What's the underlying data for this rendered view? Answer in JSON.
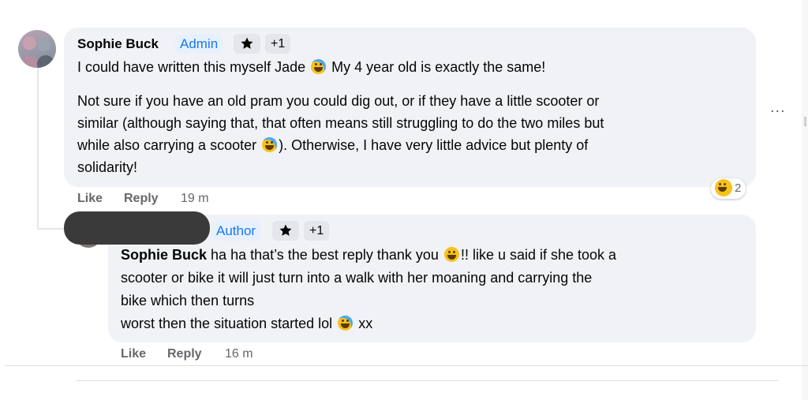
{
  "comment": {
    "author": "Sophie Buck",
    "role_badge": "Admin",
    "extra_badges": "+1",
    "line1_a": "I could have written this myself Jade",
    "line1_b": "My 4 year old is exactly the same!",
    "para2_l1": "Not sure if you have an old pram you could dig out, or if they have a little scooter or",
    "para2_l2": "similar (although saying that, that often means still struggling to do the two miles but",
    "para2_l3a": "while also carrying a scooter",
    "para2_l3b": "). Otherwise, I have very little advice but plenty of",
    "para2_l4": "solidarity!",
    "like_label": "Like",
    "reply_label": "Reply",
    "timestamp": "19 m",
    "reaction_count": "2",
    "reaction_icon": "laughing-emoji",
    "more_label": "..."
  },
  "reply": {
    "role_badge": "Author",
    "extra_badges": "+1",
    "mention": "Sophie Buck",
    "line1_a": "ha ha that’s the best reply thank you",
    "line1_b": "!! like u said if she took a",
    "line2": "scooter or bike it will just turn into a walk with her moaning and carrying the",
    "line3": "bike which then turns",
    "line4_a": "worst then the situation started lol",
    "line4_b": "xx",
    "like_label": "Like",
    "reply_label": "Reply",
    "timestamp": "16 m"
  },
  "colors": {
    "bubble": "#f0f2f5",
    "badge_bg": "#e7f0fd",
    "badge_text": "#1877f2",
    "meta_text": "#65676b"
  }
}
